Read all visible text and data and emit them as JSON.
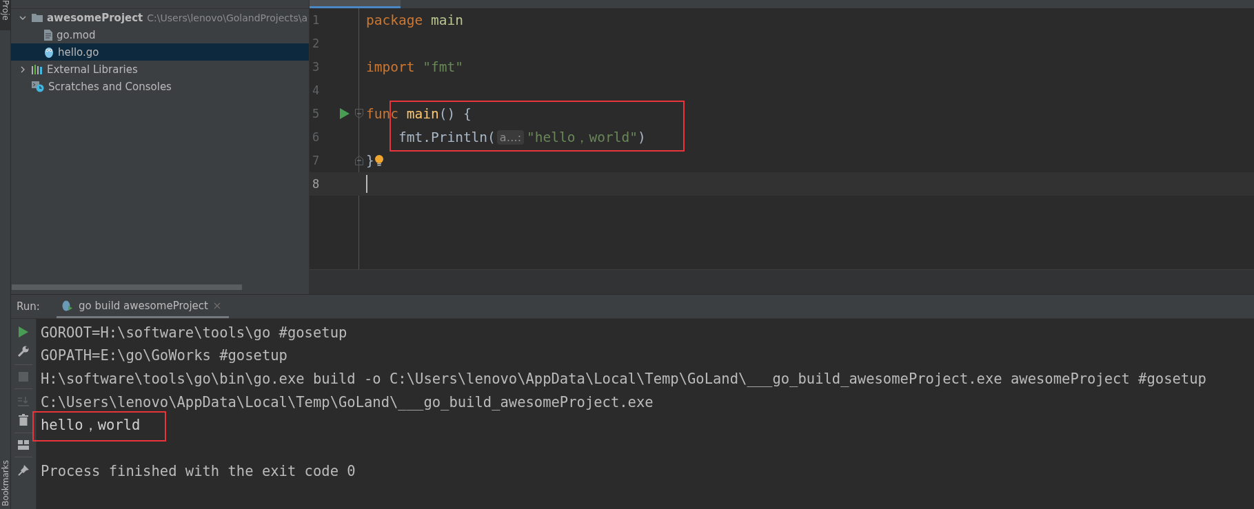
{
  "tool_stripe": {
    "top_tab": {
      "label": "Proje",
      "selected": true
    },
    "bottom_tab": {
      "label": "Bookmarks",
      "selected": false
    }
  },
  "project_tree": {
    "items": [
      {
        "label": "awesomeProject",
        "path": "C:\\Users\\lenovo\\GolandProjects\\a",
        "kind": "folder",
        "expanded": true,
        "selected": false,
        "children": [
          {
            "label": "go.mod",
            "kind": "file",
            "selected": false
          },
          {
            "label": "hello.go",
            "kind": "gofile",
            "selected": true
          }
        ]
      },
      {
        "label": "External Libraries",
        "kind": "libraries",
        "expanded": false,
        "selected": false
      },
      {
        "label": "Scratches and Consoles",
        "kind": "scratches",
        "selected": false
      }
    ]
  },
  "editor": {
    "lines": [
      {
        "number": "1",
        "run": false,
        "fold": false,
        "bulb": false,
        "current": false,
        "tokens": [
          {
            "kind": "keyword",
            "text": "package"
          },
          {
            "kind": "package",
            "text": " main"
          }
        ]
      },
      {
        "number": "2",
        "run": false,
        "fold": false,
        "bulb": false,
        "current": false
      },
      {
        "number": "3",
        "run": false,
        "fold": false,
        "bulb": false,
        "current": false,
        "tokens": [
          {
            "kind": "keyword",
            "text": "import"
          },
          {
            "kind": "string",
            "text": " \"fmt\""
          }
        ]
      },
      {
        "number": "4",
        "run": false,
        "fold": false,
        "bulb": false,
        "current": false
      },
      {
        "number": "5",
        "run": true,
        "fold": true,
        "bulb": false,
        "current": false,
        "tokens": [
          {
            "kind": "keyword",
            "text": "func"
          },
          {
            "kind": "function",
            "text": " main"
          },
          {
            "kind": "plain",
            "text": "() {"
          }
        ]
      },
      {
        "number": "6",
        "run": false,
        "fold": false,
        "bulb": false,
        "current": false,
        "tokens": [
          {
            "kind": "plain",
            "text": "    fmt.Println("
          },
          {
            "kind": "hint",
            "text": "a…:"
          },
          {
            "kind": "string",
            "text": "\"hello，world\""
          },
          {
            "kind": "plain",
            "text": ")"
          }
        ]
      },
      {
        "number": "7",
        "run": false,
        "fold": true,
        "bulb": true,
        "current": false,
        "tokens": [
          {
            "kind": "plain",
            "text": "}"
          }
        ]
      },
      {
        "number": "8",
        "run": false,
        "fold": false,
        "bulb": false,
        "current": true
      }
    ]
  },
  "run_panel": {
    "title": "Run:",
    "tabs": [
      {
        "label": "go build awesomeProject",
        "selected": true
      }
    ],
    "console_lines": [
      {
        "kind": "command",
        "text": "GOROOT=H:\\software\\tools\\go #gosetup"
      },
      {
        "kind": "command",
        "text": "GOPATH=E:\\go\\GoWorks #gosetup"
      },
      {
        "kind": "command",
        "text": "H:\\software\\tools\\go\\bin\\go.exe build -o C:\\Users\\lenovo\\AppData\\Local\\Temp\\GoLand\\___go_build_awesomeProject.exe awesomeProject #gosetup"
      },
      {
        "kind": "command",
        "text": "C:\\Users\\lenovo\\AppData\\Local\\Temp\\GoLand\\___go_build_awesomeProject.exe"
      },
      {
        "kind": "output",
        "text": "hello，world"
      },
      {
        "kind": "exit",
        "text": "Process finished with the exit code 0"
      }
    ]
  }
}
